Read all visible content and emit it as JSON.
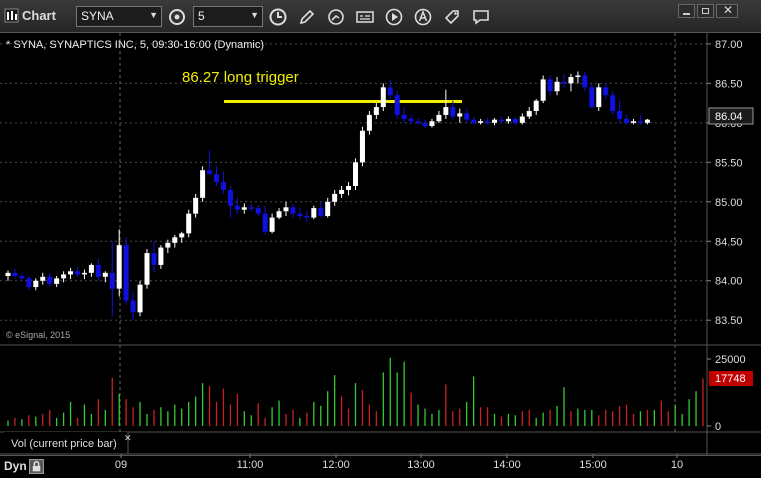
{
  "window": {
    "title": "Chart"
  },
  "toolbar": {
    "symbol": "SYNA",
    "interval": "5"
  },
  "chart": {
    "header": "* SYNA, SYNAPTICS INC, 5, 09:30-16:00 (Dynamic)",
    "annotation": "86.27 long trigger",
    "copyright": "© eSignal, 2015",
    "current_price_label": "86.04",
    "price_ticks": [
      "87.00",
      "86.50",
      "86.00",
      "85.50",
      "85.00",
      "84.50",
      "84.00",
      "83.50"
    ],
    "volume_ticks": [
      "25000",
      "0"
    ],
    "current_volume_label": "17748",
    "volume_legend": "Vol (current price bar)",
    "time_ticks": [
      "09",
      "11:00",
      "12:00",
      "13:00",
      "14:00",
      "15:00",
      "10"
    ],
    "colors": {
      "up": "#ffffff",
      "down": "#1010e0",
      "vol_up": "#33cc33",
      "vol_down": "#cc2020",
      "trigger": "#f2ee00",
      "volume_badge": "#c00000"
    }
  },
  "chart_data": {
    "type": "candlestick",
    "ylim": [
      83.3,
      87.1
    ],
    "volume_ylim": [
      0,
      28000
    ],
    "trigger_level": 86.27,
    "candles": [
      {
        "o": 84.06,
        "h": 84.13,
        "l": 84.0,
        "c": 84.1
      },
      {
        "o": 84.1,
        "h": 84.15,
        "l": 84.03,
        "c": 84.06
      },
      {
        "o": 84.06,
        "h": 84.1,
        "l": 84.0,
        "c": 84.03
      },
      {
        "o": 84.03,
        "h": 84.06,
        "l": 83.88,
        "c": 83.92
      },
      {
        "o": 83.92,
        "h": 84.03,
        "l": 83.88,
        "c": 84.0
      },
      {
        "o": 84.0,
        "h": 84.1,
        "l": 83.95,
        "c": 84.05
      },
      {
        "o": 84.05,
        "h": 84.1,
        "l": 83.93,
        "c": 83.96
      },
      {
        "o": 83.96,
        "h": 84.06,
        "l": 83.92,
        "c": 84.03
      },
      {
        "o": 84.03,
        "h": 84.12,
        "l": 83.98,
        "c": 84.08
      },
      {
        "o": 84.08,
        "h": 84.16,
        "l": 84.02,
        "c": 84.12
      },
      {
        "o": 84.12,
        "h": 84.18,
        "l": 84.05,
        "c": 84.08
      },
      {
        "o": 84.08,
        "h": 84.14,
        "l": 84.02,
        "c": 84.1
      },
      {
        "o": 84.1,
        "h": 84.22,
        "l": 84.05,
        "c": 84.2
      },
      {
        "o": 84.2,
        "h": 84.28,
        "l": 84.0,
        "c": 84.05
      },
      {
        "o": 84.05,
        "h": 84.12,
        "l": 83.98,
        "c": 84.1
      },
      {
        "o": 84.1,
        "h": 84.5,
        "l": 83.55,
        "c": 83.9
      },
      {
        "o": 83.9,
        "h": 84.65,
        "l": 83.8,
        "c": 84.45
      },
      {
        "o": 84.45,
        "h": 84.55,
        "l": 83.7,
        "c": 83.75
      },
      {
        "o": 83.75,
        "h": 83.85,
        "l": 83.5,
        "c": 83.6
      },
      {
        "o": 83.6,
        "h": 84.0,
        "l": 83.55,
        "c": 83.95
      },
      {
        "o": 83.95,
        "h": 84.4,
        "l": 83.9,
        "c": 84.35
      },
      {
        "o": 84.35,
        "h": 84.5,
        "l": 84.1,
        "c": 84.2
      },
      {
        "o": 84.2,
        "h": 84.45,
        "l": 84.15,
        "c": 84.42
      },
      {
        "o": 84.42,
        "h": 84.52,
        "l": 84.35,
        "c": 84.48
      },
      {
        "o": 84.48,
        "h": 84.58,
        "l": 84.42,
        "c": 84.55
      },
      {
        "o": 84.55,
        "h": 84.62,
        "l": 84.48,
        "c": 84.6
      },
      {
        "o": 84.6,
        "h": 84.9,
        "l": 84.55,
        "c": 84.85
      },
      {
        "o": 84.85,
        "h": 85.1,
        "l": 84.8,
        "c": 85.05
      },
      {
        "o": 85.05,
        "h": 85.45,
        "l": 85.0,
        "c": 85.4
      },
      {
        "o": 85.4,
        "h": 85.65,
        "l": 85.35,
        "c": 85.35
      },
      {
        "o": 85.35,
        "h": 85.45,
        "l": 85.2,
        "c": 85.25
      },
      {
        "o": 85.25,
        "h": 85.38,
        "l": 85.1,
        "c": 85.15
      },
      {
        "o": 85.15,
        "h": 85.2,
        "l": 84.8,
        "c": 84.95
      },
      {
        "o": 84.95,
        "h": 85.05,
        "l": 84.85,
        "c": 84.9
      },
      {
        "o": 84.9,
        "h": 84.98,
        "l": 84.85,
        "c": 84.93
      },
      {
        "o": 84.93,
        "h": 84.98,
        "l": 84.88,
        "c": 84.92
      },
      {
        "o": 84.92,
        "h": 84.96,
        "l": 84.82,
        "c": 84.85
      },
      {
        "o": 84.85,
        "h": 84.95,
        "l": 84.58,
        "c": 84.62
      },
      {
        "o": 84.62,
        "h": 84.85,
        "l": 84.6,
        "c": 84.8
      },
      {
        "o": 84.8,
        "h": 84.92,
        "l": 84.78,
        "c": 84.88
      },
      {
        "o": 84.88,
        "h": 85.0,
        "l": 84.82,
        "c": 84.93
      },
      {
        "o": 84.93,
        "h": 84.97,
        "l": 84.8,
        "c": 84.85
      },
      {
        "o": 84.85,
        "h": 84.92,
        "l": 84.78,
        "c": 84.82
      },
      {
        "o": 84.82,
        "h": 84.88,
        "l": 84.75,
        "c": 84.8
      },
      {
        "o": 84.8,
        "h": 84.95,
        "l": 84.78,
        "c": 84.92
      },
      {
        "o": 84.92,
        "h": 85.0,
        "l": 84.8,
        "c": 84.82
      },
      {
        "o": 84.82,
        "h": 85.05,
        "l": 84.8,
        "c": 85.0
      },
      {
        "o": 85.0,
        "h": 85.15,
        "l": 84.95,
        "c": 85.1
      },
      {
        "o": 85.1,
        "h": 85.2,
        "l": 85.05,
        "c": 85.15
      },
      {
        "o": 85.15,
        "h": 85.25,
        "l": 85.08,
        "c": 85.2
      },
      {
        "o": 85.2,
        "h": 85.55,
        "l": 85.15,
        "c": 85.5
      },
      {
        "o": 85.5,
        "h": 85.95,
        "l": 85.45,
        "c": 85.9
      },
      {
        "o": 85.9,
        "h": 86.15,
        "l": 85.85,
        "c": 86.1
      },
      {
        "o": 86.1,
        "h": 86.25,
        "l": 86.05,
        "c": 86.2
      },
      {
        "o": 86.2,
        "h": 86.5,
        "l": 86.15,
        "c": 86.45
      },
      {
        "o": 86.45,
        "h": 86.55,
        "l": 86.3,
        "c": 86.35
      },
      {
        "o": 86.35,
        "h": 86.4,
        "l": 86.05,
        "c": 86.1
      },
      {
        "o": 86.1,
        "h": 86.2,
        "l": 86.0,
        "c": 86.05
      },
      {
        "o": 86.05,
        "h": 86.1,
        "l": 85.98,
        "c": 86.02
      },
      {
        "o": 86.02,
        "h": 86.06,
        "l": 85.97,
        "c": 86.0
      },
      {
        "o": 86.0,
        "h": 86.04,
        "l": 85.93,
        "c": 85.96
      },
      {
        "o": 85.96,
        "h": 86.05,
        "l": 85.94,
        "c": 86.02
      },
      {
        "o": 86.02,
        "h": 86.15,
        "l": 86.0,
        "c": 86.1
      },
      {
        "o": 86.1,
        "h": 86.42,
        "l": 86.05,
        "c": 86.2
      },
      {
        "o": 86.2,
        "h": 86.28,
        "l": 86.05,
        "c": 86.08
      },
      {
        "o": 86.08,
        "h": 86.18,
        "l": 86.0,
        "c": 86.12
      },
      {
        "o": 86.12,
        "h": 86.18,
        "l": 86.0,
        "c": 86.04
      },
      {
        "o": 86.04,
        "h": 86.08,
        "l": 85.98,
        "c": 86.0
      },
      {
        "o": 86.0,
        "h": 86.05,
        "l": 85.98,
        "c": 86.02
      },
      {
        "o": 86.02,
        "h": 86.06,
        "l": 85.98,
        "c": 86.0
      },
      {
        "o": 86.0,
        "h": 86.06,
        "l": 85.97,
        "c": 86.04
      },
      {
        "o": 86.04,
        "h": 86.08,
        "l": 85.99,
        "c": 86.02
      },
      {
        "o": 86.02,
        "h": 86.08,
        "l": 85.99,
        "c": 86.05
      },
      {
        "o": 86.05,
        "h": 86.08,
        "l": 85.97,
        "c": 86.0
      },
      {
        "o": 86.0,
        "h": 86.12,
        "l": 85.98,
        "c": 86.08
      },
      {
        "o": 86.08,
        "h": 86.2,
        "l": 86.05,
        "c": 86.15
      },
      {
        "o": 86.15,
        "h": 86.3,
        "l": 86.1,
        "c": 86.28
      },
      {
        "o": 86.28,
        "h": 86.6,
        "l": 86.25,
        "c": 86.55
      },
      {
        "o": 86.55,
        "h": 86.6,
        "l": 86.35,
        "c": 86.4
      },
      {
        "o": 86.4,
        "h": 86.58,
        "l": 86.35,
        "c": 86.52
      },
      {
        "o": 86.52,
        "h": 86.62,
        "l": 86.45,
        "c": 86.5
      },
      {
        "o": 86.5,
        "h": 86.62,
        "l": 86.4,
        "c": 86.58
      },
      {
        "o": 86.58,
        "h": 86.65,
        "l": 86.5,
        "c": 86.6
      },
      {
        "o": 86.6,
        "h": 86.65,
        "l": 86.4,
        "c": 86.45
      },
      {
        "o": 86.45,
        "h": 86.5,
        "l": 86.18,
        "c": 86.2
      },
      {
        "o": 86.2,
        "h": 86.5,
        "l": 86.15,
        "c": 86.45
      },
      {
        "o": 86.45,
        "h": 86.5,
        "l": 86.3,
        "c": 86.35
      },
      {
        "o": 86.35,
        "h": 86.4,
        "l": 86.1,
        "c": 86.15
      },
      {
        "o": 86.15,
        "h": 86.28,
        "l": 86.0,
        "c": 86.05
      },
      {
        "o": 86.05,
        "h": 86.1,
        "l": 85.98,
        "c": 86.0
      },
      {
        "o": 86.0,
        "h": 86.05,
        "l": 85.98,
        "c": 86.02
      },
      {
        "o": 86.02,
        "h": 86.1,
        "l": 85.98,
        "c": 86.0
      },
      {
        "o": 86.0,
        "h": 86.05,
        "l": 85.98,
        "c": 86.04
      }
    ],
    "volumes": [
      {
        "v": 2000,
        "up": true
      },
      {
        "v": 3000,
        "up": false
      },
      {
        "v": 2500,
        "up": true
      },
      {
        "v": 4000,
        "up": false
      },
      {
        "v": 3500,
        "up": true
      },
      {
        "v": 4500,
        "up": false
      },
      {
        "v": 6000,
        "up": false
      },
      {
        "v": 3000,
        "up": true
      },
      {
        "v": 5000,
        "up": true
      },
      {
        "v": 9000,
        "up": true
      },
      {
        "v": 3000,
        "up": false
      },
      {
        "v": 8000,
        "up": true
      },
      {
        "v": 4500,
        "up": true
      },
      {
        "v": 10000,
        "up": false
      },
      {
        "v": 6000,
        "up": true
      },
      {
        "v": 18000,
        "up": false
      },
      {
        "v": 12000,
        "up": true
      },
      {
        "v": 10000,
        "up": false
      },
      {
        "v": 7000,
        "up": false
      },
      {
        "v": 9000,
        "up": true
      },
      {
        "v": 4500,
        "up": true
      },
      {
        "v": 6000,
        "up": false
      },
      {
        "v": 7000,
        "up": true
      },
      {
        "v": 5500,
        "up": true
      },
      {
        "v": 8000,
        "up": true
      },
      {
        "v": 6500,
        "up": true
      },
      {
        "v": 9000,
        "up": true
      },
      {
        "v": 11000,
        "up": true
      },
      {
        "v": 16000,
        "up": true
      },
      {
        "v": 15000,
        "up": false
      },
      {
        "v": 9000,
        "up": false
      },
      {
        "v": 14000,
        "up": false
      },
      {
        "v": 8000,
        "up": false
      },
      {
        "v": 12000,
        "up": false
      },
      {
        "v": 5500,
        "up": true
      },
      {
        "v": 4000,
        "up": true
      },
      {
        "v": 8500,
        "up": false
      },
      {
        "v": 3000,
        "up": false
      },
      {
        "v": 7000,
        "up": true
      },
      {
        "v": 9500,
        "up": true
      },
      {
        "v": 4500,
        "up": false
      },
      {
        "v": 6000,
        "up": false
      },
      {
        "v": 3000,
        "up": true
      },
      {
        "v": 5000,
        "up": false
      },
      {
        "v": 9000,
        "up": true
      },
      {
        "v": 7500,
        "up": true
      },
      {
        "v": 13000,
        "up": true
      },
      {
        "v": 19000,
        "up": true
      },
      {
        "v": 11000,
        "up": false
      },
      {
        "v": 6500,
        "up": false
      },
      {
        "v": 16000,
        "up": true
      },
      {
        "v": 13500,
        "up": false
      },
      {
        "v": 8000,
        "up": false
      },
      {
        "v": 5500,
        "up": false
      },
      {
        "v": 20000,
        "up": true
      },
      {
        "v": 25500,
        "up": true
      },
      {
        "v": 20000,
        "up": true
      },
      {
        "v": 24000,
        "up": true
      },
      {
        "v": 12500,
        "up": false
      },
      {
        "v": 8000,
        "up": true
      },
      {
        "v": 6500,
        "up": true
      },
      {
        "v": 4500,
        "up": true
      },
      {
        "v": 6000,
        "up": true
      },
      {
        "v": 15500,
        "up": false
      },
      {
        "v": 5500,
        "up": false
      },
      {
        "v": 6500,
        "up": false
      },
      {
        "v": 9000,
        "up": true
      },
      {
        "v": 18500,
        "up": true
      },
      {
        "v": 7000,
        "up": false
      },
      {
        "v": 7000,
        "up": false
      },
      {
        "v": 4500,
        "up": true
      },
      {
        "v": 3500,
        "up": false
      },
      {
        "v": 4500,
        "up": true
      },
      {
        "v": 4000,
        "up": true
      },
      {
        "v": 5500,
        "up": false
      },
      {
        "v": 6000,
        "up": false
      },
      {
        "v": 3000,
        "up": true
      },
      {
        "v": 5000,
        "up": true
      },
      {
        "v": 6000,
        "up": false
      },
      {
        "v": 7500,
        "up": true
      },
      {
        "v": 14500,
        "up": true
      },
      {
        "v": 5500,
        "up": false
      },
      {
        "v": 6500,
        "up": true
      },
      {
        "v": 6000,
        "up": true
      },
      {
        "v": 6000,
        "up": true
      },
      {
        "v": 4000,
        "up": false
      },
      {
        "v": 6000,
        "up": false
      },
      {
        "v": 5500,
        "up": false
      },
      {
        "v": 7500,
        "up": false
      },
      {
        "v": 8000,
        "up": false
      },
      {
        "v": 4500,
        "up": false
      },
      {
        "v": 5500,
        "up": true
      },
      {
        "v": 6000,
        "up": false
      },
      {
        "v": 6000,
        "up": true
      },
      {
        "v": 9500,
        "up": false
      },
      {
        "v": 5500,
        "up": false
      },
      {
        "v": 8000,
        "up": true
      },
      {
        "v": 4500,
        "up": true
      },
      {
        "v": 10000,
        "up": true
      },
      {
        "v": 13000,
        "up": true
      },
      {
        "v": 17748,
        "up": false
      }
    ]
  }
}
